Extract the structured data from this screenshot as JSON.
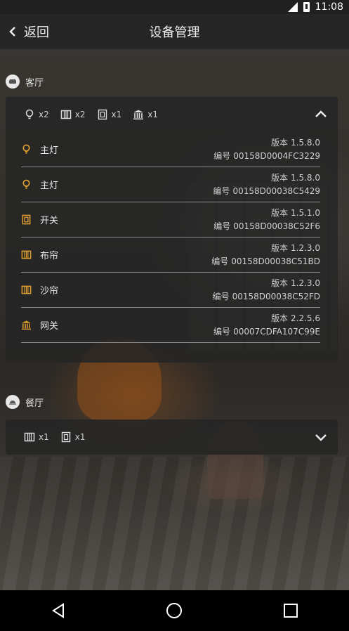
{
  "status_bar": {
    "time": "11:08"
  },
  "nav": {
    "back_label": "返回",
    "title": "设备管理"
  },
  "rooms": [
    {
      "name": "客厅",
      "expanded": true,
      "summary": [
        {
          "icon": "bulb-icon",
          "count": "x2"
        },
        {
          "icon": "curtain-icon",
          "count": "x2"
        },
        {
          "icon": "switch-icon",
          "count": "x1"
        },
        {
          "icon": "gateway-icon",
          "count": "x1"
        }
      ],
      "devices": [
        {
          "icon": "bulb-icon",
          "name": "主灯",
          "version_label": "版本",
          "version": "1.5.8.0",
          "serial_label": "编号",
          "serial": "00158D0004FC3229"
        },
        {
          "icon": "bulb-icon",
          "name": "主灯",
          "version_label": "版本",
          "version": "1.5.8.0",
          "serial_label": "编号",
          "serial": "00158D00038C5429"
        },
        {
          "icon": "switch-icon",
          "name": "开关",
          "version_label": "版本",
          "version": "1.5.1.0",
          "serial_label": "编号",
          "serial": "00158D00038C52F6"
        },
        {
          "icon": "curtain-icon",
          "name": "布帘",
          "version_label": "版本",
          "version": "1.2.3.0",
          "serial_label": "编号",
          "serial": "00158D00038C51BD"
        },
        {
          "icon": "curtain-icon",
          "name": "沙帘",
          "version_label": "版本",
          "version": "1.2.3.0",
          "serial_label": "编号",
          "serial": "00158D00038C52FD"
        },
        {
          "icon": "gateway-icon",
          "name": "网关",
          "version_label": "版本",
          "version": "2.2.5.6",
          "serial_label": "编号",
          "serial": "00007CDFA107C99E"
        }
      ]
    },
    {
      "name": "餐厅",
      "expanded": false,
      "summary": [
        {
          "icon": "curtain-icon",
          "count": "x1"
        },
        {
          "icon": "switch-icon",
          "count": "x1"
        }
      ]
    }
  ],
  "colors": {
    "accent": "#e0a030",
    "card_bg": "#262626",
    "nav_bg": "#262626"
  }
}
